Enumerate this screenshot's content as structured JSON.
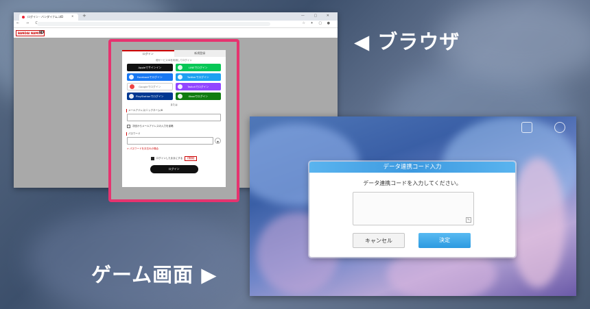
{
  "browser_label": "◀ ブラウザ",
  "game_label": "ゲーム画面 ▶",
  "browser": {
    "tab_title": "ログイン - バンダイナムコID",
    "new_tab": "+",
    "window_controls": "—  ▢  ✕",
    "nav": "←  →  C  ⌂",
    "brand_logo": "BANDAI NAMCO",
    "brand_id": "ID"
  },
  "login": {
    "tabs": [
      "ログイン",
      "新規登録"
    ],
    "note": "他サービスIDを利用してログイン",
    "social": [
      {
        "label": "Appleでサインイン",
        "color": "#111111"
      },
      {
        "label": "LINEでログイン",
        "color": "#06c755"
      },
      {
        "label": "Facebookでログイン",
        "color": "#1877f2"
      },
      {
        "label": "Twitterでログイン",
        "color": "#1da1f2"
      },
      {
        "label": "Googleでログイン",
        "color": "#ffffff"
      },
      {
        "label": "Twitchでログイン",
        "color": "#9146ff"
      },
      {
        "label": "PlayStationでログイン",
        "color": "#003791"
      },
      {
        "label": "Xboxでログイン",
        "color": "#107c10"
      }
    ],
    "or": "または",
    "email_label": "メールアドレス/ニックネームID",
    "skip_label": "次回からメールアドレスの入力を省略",
    "password_label": "パスワード",
    "forgot": "> パスワードをお忘れの場合",
    "keep_label": "ログインしたままにする",
    "keep_badge": "【推奨】",
    "login_button": "ログイン"
  },
  "dialog": {
    "title": "データ連携コード入力",
    "message": "データ連携コードを入力してください。",
    "cancel": "キャンセル",
    "ok": "決定"
  }
}
